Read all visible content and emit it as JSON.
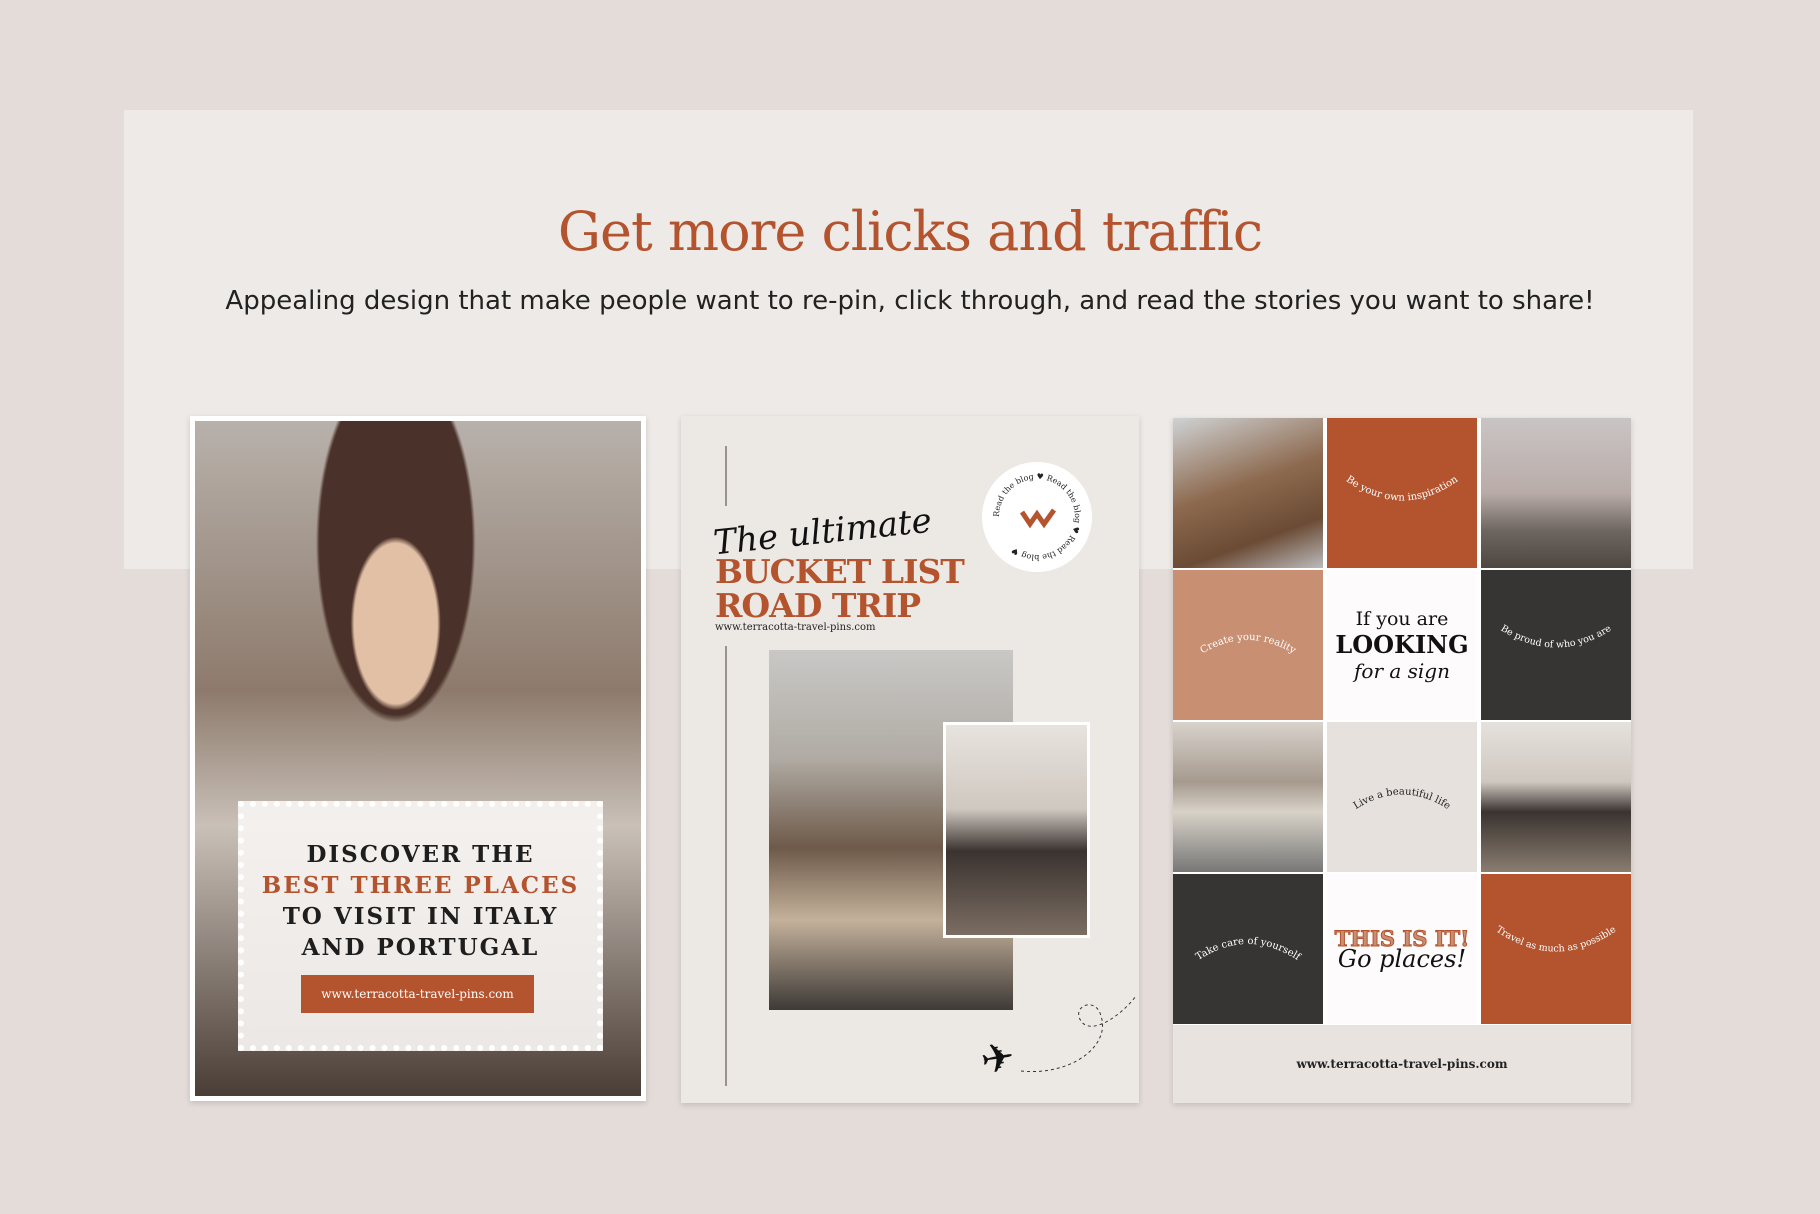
{
  "header": {
    "title": "Get more clicks and traffic",
    "subtitle": "Appealing design that make people want to re-pin, click through, and read the stories you want to share!"
  },
  "colors": {
    "accent": "#b4542f",
    "tan": "#c88f72",
    "charcoal": "#373533",
    "background": "#e4dcd8"
  },
  "card1": {
    "lines": [
      "DISCOVER THE",
      "BEST THREE PLACES",
      "TO VISIT IN ITALY",
      "AND PORTUGAL"
    ],
    "button": "www.terracotta-travel-pins.com"
  },
  "card2": {
    "script": "The ultimate",
    "line1": "BUCKET LIST",
    "line2": "ROAD TRIP",
    "url": "www.terracotta-travel-pins.com",
    "badge_text": "Read the blog ♥ Read the blog ♥ Read the blog ♥",
    "icon": "airplane-icon"
  },
  "card3": {
    "quotes": {
      "inspiration": "Be your own inspiration",
      "reality": "Create your reality",
      "proud": "Be proud of who you are",
      "beautiful": "Live a beautiful life",
      "care": "Take care of yourself",
      "travel": "Travel as much as possible"
    },
    "sign": {
      "line1": "If you are",
      "line2": "LOOKING",
      "line3": "for a sign"
    },
    "this": {
      "line1": "THIS IS IT!",
      "line2": "Go places!"
    },
    "url": "www.terracotta-travel-pins.com"
  }
}
